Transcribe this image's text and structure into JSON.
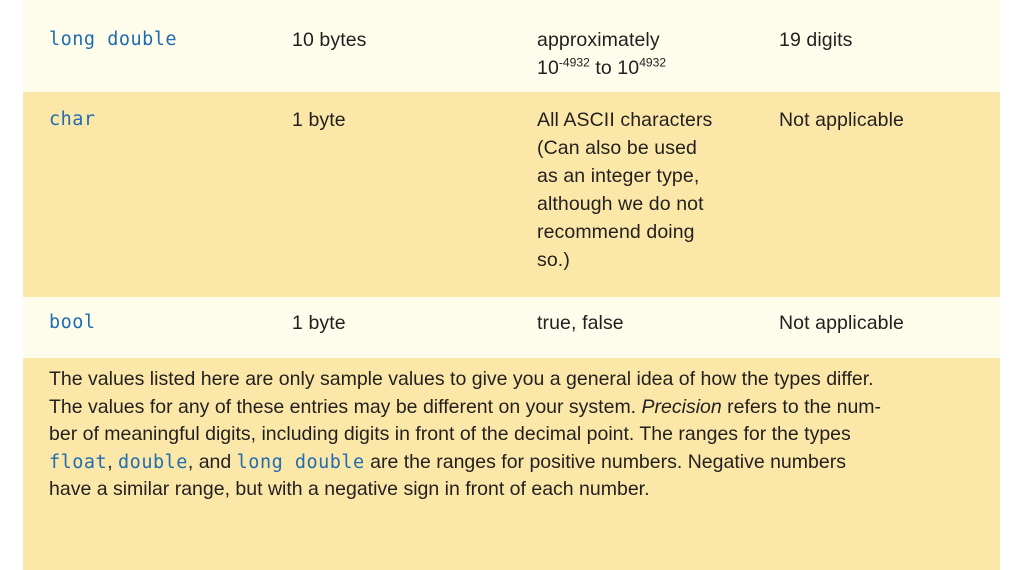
{
  "colors": {
    "row_light": "#fefcea",
    "row_dark": "#fbe8a8",
    "code_blue": "#1f6cb0",
    "text": "#231f20",
    "page_background": "#ffffff"
  },
  "table": {
    "rows": [
      {
        "type_name": "long double",
        "size": "10 bytes",
        "range_prefix": "approximately",
        "range_line2_base1": "10",
        "range_line2_exp1": "-4932",
        "range_line2_mid": " to ",
        "range_line2_base2": "10",
        "range_line2_exp2": "4932",
        "precision": "19 digits"
      },
      {
        "type_name": "char",
        "size": "1 byte",
        "range": "All ASCII characters\n(Can also be used\nas an integer type,\nalthough we do not\nrecommend doing\nso.)",
        "precision": "Not applicable"
      },
      {
        "type_name": "bool",
        "size": "1 byte",
        "range_true": "true",
        "range_separator": ", ",
        "range_false": "false",
        "precision": "Not applicable"
      }
    ]
  },
  "footnote": {
    "line1": "The values listed here are only sample values to give you a general idea of how the types differ.",
    "line2_a": "The values for any of these entries may be different on your system. ",
    "line2_italic": "Precision",
    "line2_b": " refers to the num-",
    "line3_a": "ber of meaningful digits, including digits in front of the decimal point. The ranges for the types",
    "line4_kw1": "float",
    "line4_a": ", ",
    "line4_kw2": "double",
    "line4_b": ", and ",
    "line4_kw3": "long double",
    "line4_c": " are the ranges for positive numbers. Negative numbers",
    "line5": "have a similar range, but with a negative sign in front of each number."
  }
}
